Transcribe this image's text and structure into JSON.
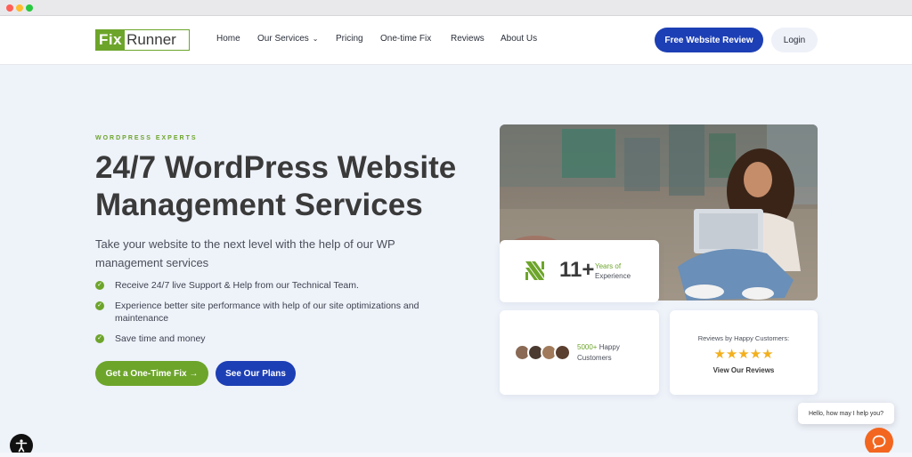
{
  "browser": {
    "dots": [
      "red",
      "yellow",
      "green"
    ]
  },
  "header": {
    "logo": {
      "fix": "Fix",
      "runner": "Runner"
    },
    "nav": [
      {
        "label": "Home"
      },
      {
        "label": "Our Services",
        "has_dropdown": true
      },
      {
        "label": "Pricing"
      },
      {
        "label": "One-time Fix"
      },
      {
        "label": "Reviews"
      },
      {
        "label": "About Us"
      }
    ],
    "cta_label": "Free Website Review",
    "login_label": "Login"
  },
  "hero": {
    "eyebrow": "WORDPRESS EXPERTS",
    "headline_line1": "24/7 WordPress Website",
    "headline_line2": "Management Services",
    "subtext": "Take your website to the next level with the help of our WP management services",
    "checklist": [
      "Receive 24/7 live Support & Help from our Technical Team.",
      "Experience better site performance with help of our site optimizations and maintenance",
      "Save time and money"
    ],
    "primary_button": "Get a One-Time Fix →",
    "secondary_button": "See Our Plans"
  },
  "stats": {
    "years_value": "11+",
    "years_label_1": "Years of",
    "years_label_2": "Experience",
    "happy_value": "5000+",
    "happy_label_1": " Happy",
    "happy_label_2": "Customers",
    "reviews_title": "Reviews by Happy Customers:",
    "stars": "★★★★★",
    "rating": 5,
    "reviews_link": "View Our Reviews"
  },
  "chat": {
    "greeting": "Hello, how may I help you?"
  },
  "colors": {
    "brand_green": "#6da52b",
    "brand_blue": "#1d3fb5",
    "chat_orange": "#f2661f",
    "star": "#f2b01e"
  },
  "icons": {
    "check": "check-circle-icon",
    "chat": "chat-icon",
    "accessibility": "accessibility-icon",
    "years_logo": "fixrunner-mark-icon"
  }
}
